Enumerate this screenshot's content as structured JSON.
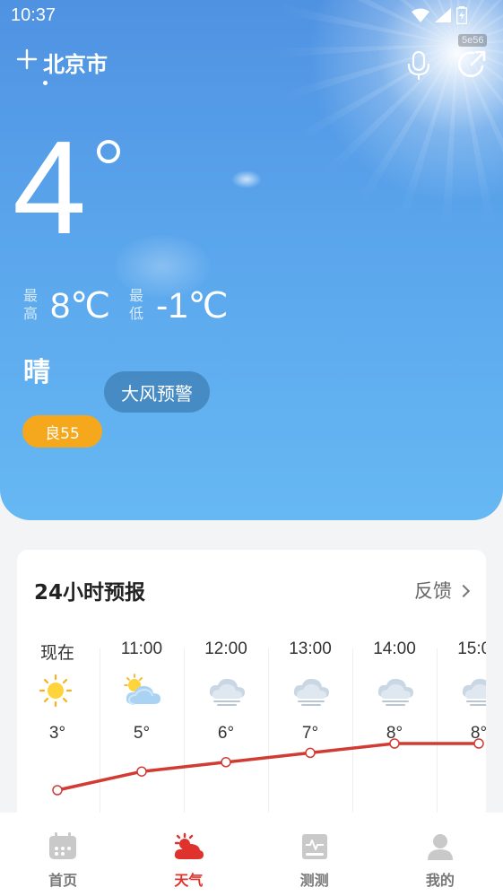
{
  "status_bar": {
    "time": "10:37"
  },
  "header": {
    "city": "北京市",
    "code_badge": "5e56"
  },
  "current": {
    "temperature": "4",
    "high_label": "最高",
    "high_value": "8℃",
    "low_label": "最低",
    "low_value": "-1℃",
    "condition": "晴",
    "warning_label": "大风预警",
    "aqi_label": "良55"
  },
  "forecast": {
    "title": "24小时预报",
    "feedback_label": "反馈",
    "hours": [
      {
        "time": "现在",
        "icon": "sunny-icon",
        "temp": "3°",
        "value": 3
      },
      {
        "time": "11:00",
        "icon": "partly-cloudy-icon",
        "temp": "5°",
        "value": 5
      },
      {
        "time": "12:00",
        "icon": "cloudy-icon",
        "temp": "6°",
        "value": 6
      },
      {
        "time": "13:00",
        "icon": "cloudy-icon",
        "temp": "7°",
        "value": 7
      },
      {
        "time": "14:00",
        "icon": "cloudy-icon",
        "temp": "8°",
        "value": 8
      },
      {
        "time": "15:00",
        "icon": "cloudy-icon",
        "temp": "8°",
        "value": 8
      }
    ]
  },
  "colors": {
    "line": "#d23b34",
    "aqi": "#f6a81c",
    "active": "#e0322c"
  },
  "nav": [
    {
      "label": "首页",
      "icon": "calendar-icon",
      "active": false
    },
    {
      "label": "天气",
      "icon": "weather-icon",
      "active": true
    },
    {
      "label": "测测",
      "icon": "monitor-icon",
      "active": false
    },
    {
      "label": "我的",
      "icon": "person-icon",
      "active": false
    }
  ]
}
